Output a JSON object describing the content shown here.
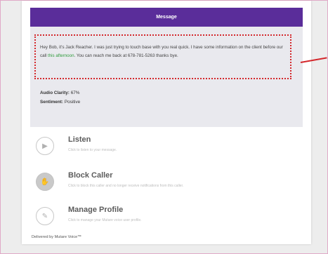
{
  "header": {
    "title": "Message"
  },
  "message": {
    "text_before": "Hey Bob, it's Jack Reacher. I was just trying to touch base with you real quick. I have some information on the client before our call ",
    "text_highlight": "this afternoon",
    "text_after": ". You can reach me back at 678-781-5263 thanks bye."
  },
  "stats": {
    "clarity_label": "Audio Clarity:",
    "clarity_value": "67%",
    "sentiment_label": "Sentiment:",
    "sentiment_value": "Positive"
  },
  "actions": [
    {
      "title": "Listen",
      "subtitle": "Click to listen to your message.",
      "icon": "play-icon"
    },
    {
      "title": "Block Caller",
      "subtitle": "Click to block this caller and no longer receive notifications from this caller.",
      "icon": "hand-icon"
    },
    {
      "title": "Manage Profile",
      "subtitle": "Click to manage your Mutare voice user profile.",
      "icon": "pencil-icon"
    }
  ],
  "footer": {
    "text": "Delivered by Mutare Voice™"
  },
  "colors": {
    "header": "#5a2d9a",
    "highlight": "#2f9b3c",
    "annotation": "#d4282c"
  }
}
